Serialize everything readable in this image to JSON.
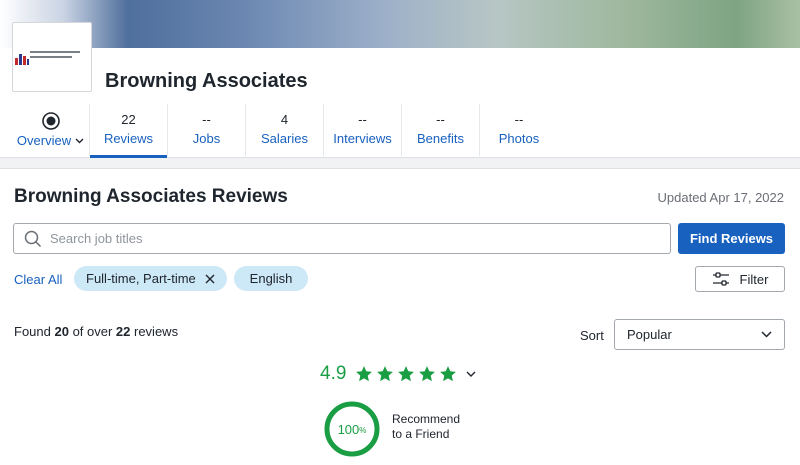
{
  "company": {
    "name": "Browning Associates",
    "logo_text": "Browning Associates"
  },
  "tabs": [
    {
      "count": "",
      "label": "Overview"
    },
    {
      "count": "22",
      "label": "Reviews"
    },
    {
      "count": "--",
      "label": "Jobs"
    },
    {
      "count": "4",
      "label": "Salaries"
    },
    {
      "count": "--",
      "label": "Interviews"
    },
    {
      "count": "--",
      "label": "Benefits"
    },
    {
      "count": "--",
      "label": "Photos"
    }
  ],
  "reviews": {
    "title": "Browning Associates Reviews",
    "updated": "Updated Apr 17, 2022",
    "search_placeholder": "Search job titles",
    "find_button": "Find Reviews",
    "clear_all": "Clear All",
    "filters": [
      "Full-time, Part-time",
      "English"
    ],
    "filter_button": "Filter",
    "found": {
      "prefix": "Found ",
      "count": "20",
      "middle": " of over ",
      "total": "22",
      "suffix": " reviews"
    },
    "sort_label": "Sort",
    "sort_value": "Popular",
    "rating": "4.9",
    "stars": 5,
    "recommend_percent": "100",
    "recommend_unit": "%",
    "recommend_label_1": "Recommend",
    "recommend_label_2": "to a Friend"
  },
  "colors": {
    "brand_blue": "#1861bf",
    "rating_green": "#1a9e44",
    "chip_bg": "#cde8f7"
  },
  "icons": {
    "overview": "target-icon",
    "search": "search-icon",
    "chip_remove": "close-icon",
    "filter": "sliders-icon",
    "sort": "chevron-down-icon",
    "rating": "star-icon"
  }
}
